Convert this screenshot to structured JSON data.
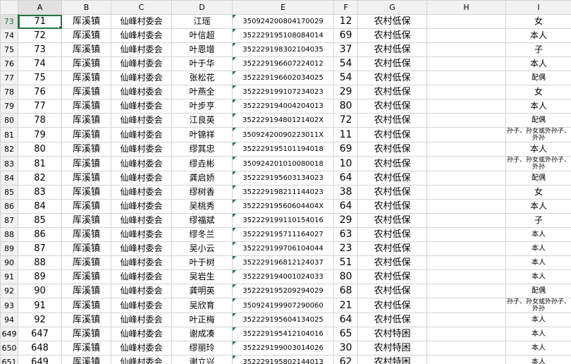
{
  "columns": [
    "A",
    "B",
    "C",
    "D",
    "E",
    "F",
    "G",
    "H",
    "I"
  ],
  "rows": [
    {
      "row": "73",
      "a": "71",
      "b": "厍溪镇",
      "c": "仙峰村委会",
      "d": "江瑶",
      "e": "350924200804170029",
      "f": "12",
      "g": "农村低保",
      "h": "",
      "i": "女"
    },
    {
      "row": "74",
      "a": "72",
      "b": "厍溪镇",
      "c": "仙峰村委会",
      "d": "叶信超",
      "e": "352229195108084014",
      "f": "69",
      "g": "农村低保",
      "h": "",
      "i": "本人"
    },
    {
      "row": "75",
      "a": "73",
      "b": "厍溪镇",
      "c": "仙峰村委会",
      "d": "叶恩增",
      "e": "352229198302104035",
      "f": "37",
      "g": "农村低保",
      "h": "",
      "i": "子"
    },
    {
      "row": "76",
      "a": "74",
      "b": "厍溪镇",
      "c": "仙峰村委会",
      "d": "叶于华",
      "e": "352229196607224012",
      "f": "54",
      "g": "农村低保",
      "h": "",
      "i": "本人"
    },
    {
      "row": "77",
      "a": "75",
      "b": "厍溪镇",
      "c": "仙峰村委会",
      "d": "张松花",
      "e": "352229196602034025",
      "f": "54",
      "g": "农村低保",
      "h": "",
      "i": "配偶"
    },
    {
      "row": "78",
      "a": "76",
      "b": "厍溪镇",
      "c": "仙峰村委会",
      "d": "叶燕全",
      "e": "352229199107234023",
      "f": "29",
      "g": "农村低保",
      "h": "",
      "i": "女"
    },
    {
      "row": "79",
      "a": "77",
      "b": "厍溪镇",
      "c": "仙峰村委会",
      "d": "叶步亨",
      "e": "352229194004204013",
      "f": "80",
      "g": "农村低保",
      "h": "",
      "i": "本人"
    },
    {
      "row": "80",
      "a": "78",
      "b": "厍溪镇",
      "c": "仙峰村委会",
      "d": "江良英",
      "e": "35222919480121402X",
      "f": "72",
      "g": "农村低保",
      "h": "",
      "i": "配偶"
    },
    {
      "row": "81",
      "a": "79",
      "b": "厍溪镇",
      "c": "仙峰村委会",
      "d": "叶锦祥",
      "e": "35092420090223011X",
      "f": "11",
      "g": "农村低保",
      "h": "",
      "i": "孙子、孙女或外孙子、外孙"
    },
    {
      "row": "82",
      "a": "80",
      "b": "厍溪镇",
      "c": "仙峰村委会",
      "d": "缪其忠",
      "e": "352229195101194018",
      "f": "69",
      "g": "农村低保",
      "h": "",
      "i": "本人"
    },
    {
      "row": "83",
      "a": "81",
      "b": "厍溪镇",
      "c": "仙峰村委会",
      "d": "缪垚彬",
      "e": "350924201010080018",
      "f": "10",
      "g": "农村低保",
      "h": "",
      "i": "孙子、孙女或外孙子、外孙"
    },
    {
      "row": "84",
      "a": "82",
      "b": "厍溪镇",
      "c": "仙峰村委会",
      "d": "龚启娇",
      "e": "352229195603134023",
      "f": "64",
      "g": "农村低保",
      "h": "",
      "i": "配偶"
    },
    {
      "row": "85",
      "a": "83",
      "b": "厍溪镇",
      "c": "仙峰村委会",
      "d": "缪树香",
      "e": "352229198211144023",
      "f": "38",
      "g": "农村低保",
      "h": "",
      "i": "女"
    },
    {
      "row": "86",
      "a": "84",
      "b": "厍溪镇",
      "c": "仙峰村委会",
      "d": "吴桃秀",
      "e": "35222919560604404X",
      "f": "64",
      "g": "农村低保",
      "h": "",
      "i": "本人"
    },
    {
      "row": "87",
      "a": "85",
      "b": "厍溪镇",
      "c": "仙峰村委会",
      "d": "缪福斌",
      "e": "352229199110154016",
      "f": "29",
      "g": "农村低保",
      "h": "",
      "i": "子"
    },
    {
      "row": "88",
      "a": "86",
      "b": "厍溪镇",
      "c": "仙峰村委会",
      "d": "缪冬兰",
      "e": "352229195711164027",
      "f": "63",
      "g": "农村低保",
      "h": "",
      "i": "本人"
    },
    {
      "row": "89",
      "a": "87",
      "b": "厍溪镇",
      "c": "仙峰村委会",
      "d": "吴小云",
      "e": "352229199706104044",
      "f": "23",
      "g": "农村低保",
      "h": "",
      "i": "本人"
    },
    {
      "row": "90",
      "a": "88",
      "b": "厍溪镇",
      "c": "仙峰村委会",
      "d": "叶于树",
      "e": "352229196812124037",
      "f": "51",
      "g": "农村低保",
      "h": "",
      "i": "本人"
    },
    {
      "row": "91",
      "a": "89",
      "b": "厍溪镇",
      "c": "仙峰村委会",
      "d": "吴岩生",
      "e": "352229194001024033",
      "f": "80",
      "g": "农村低保",
      "h": "",
      "i": "本人"
    },
    {
      "row": "92",
      "a": "90",
      "b": "厍溪镇",
      "c": "仙峰村委会",
      "d": "龚明英",
      "e": "352229195209294029",
      "f": "68",
      "g": "农村低保",
      "h": "",
      "i": "配偶"
    },
    {
      "row": "93",
      "a": "91",
      "b": "厍溪镇",
      "c": "仙峰村委会",
      "d": "吴欣育",
      "e": "350924199907290060",
      "f": "21",
      "g": "农村低保",
      "h": "",
      "i": "孙子、孙女或外孙子、外孙"
    },
    {
      "row": "94",
      "a": "92",
      "b": "厍溪镇",
      "c": "仙峰村委会",
      "d": "叶正梅",
      "e": "352229195604134025",
      "f": "64",
      "g": "农村低保",
      "h": "",
      "i": "本人"
    },
    {
      "row": "649",
      "a": "647",
      "b": "厍溪镇",
      "c": "仙峰村委会",
      "d": "谢成凑",
      "e": "352229195412104016",
      "f": "65",
      "g": "农村特困",
      "h": "",
      "i": "本人"
    },
    {
      "row": "650",
      "a": "648",
      "b": "厍溪镇",
      "c": "仙峰村委会",
      "d": "缪丽玲",
      "e": "352229199003014026",
      "f": "30",
      "g": "农村特困",
      "h": "",
      "i": "本人"
    },
    {
      "row": "651",
      "a": "649",
      "b": "厍溪镇",
      "c": "仙峰村委会",
      "d": "谢立兴",
      "e": "352229195802144013",
      "f": "62",
      "g": "农村特困",
      "h": "",
      "i": "本人"
    }
  ]
}
